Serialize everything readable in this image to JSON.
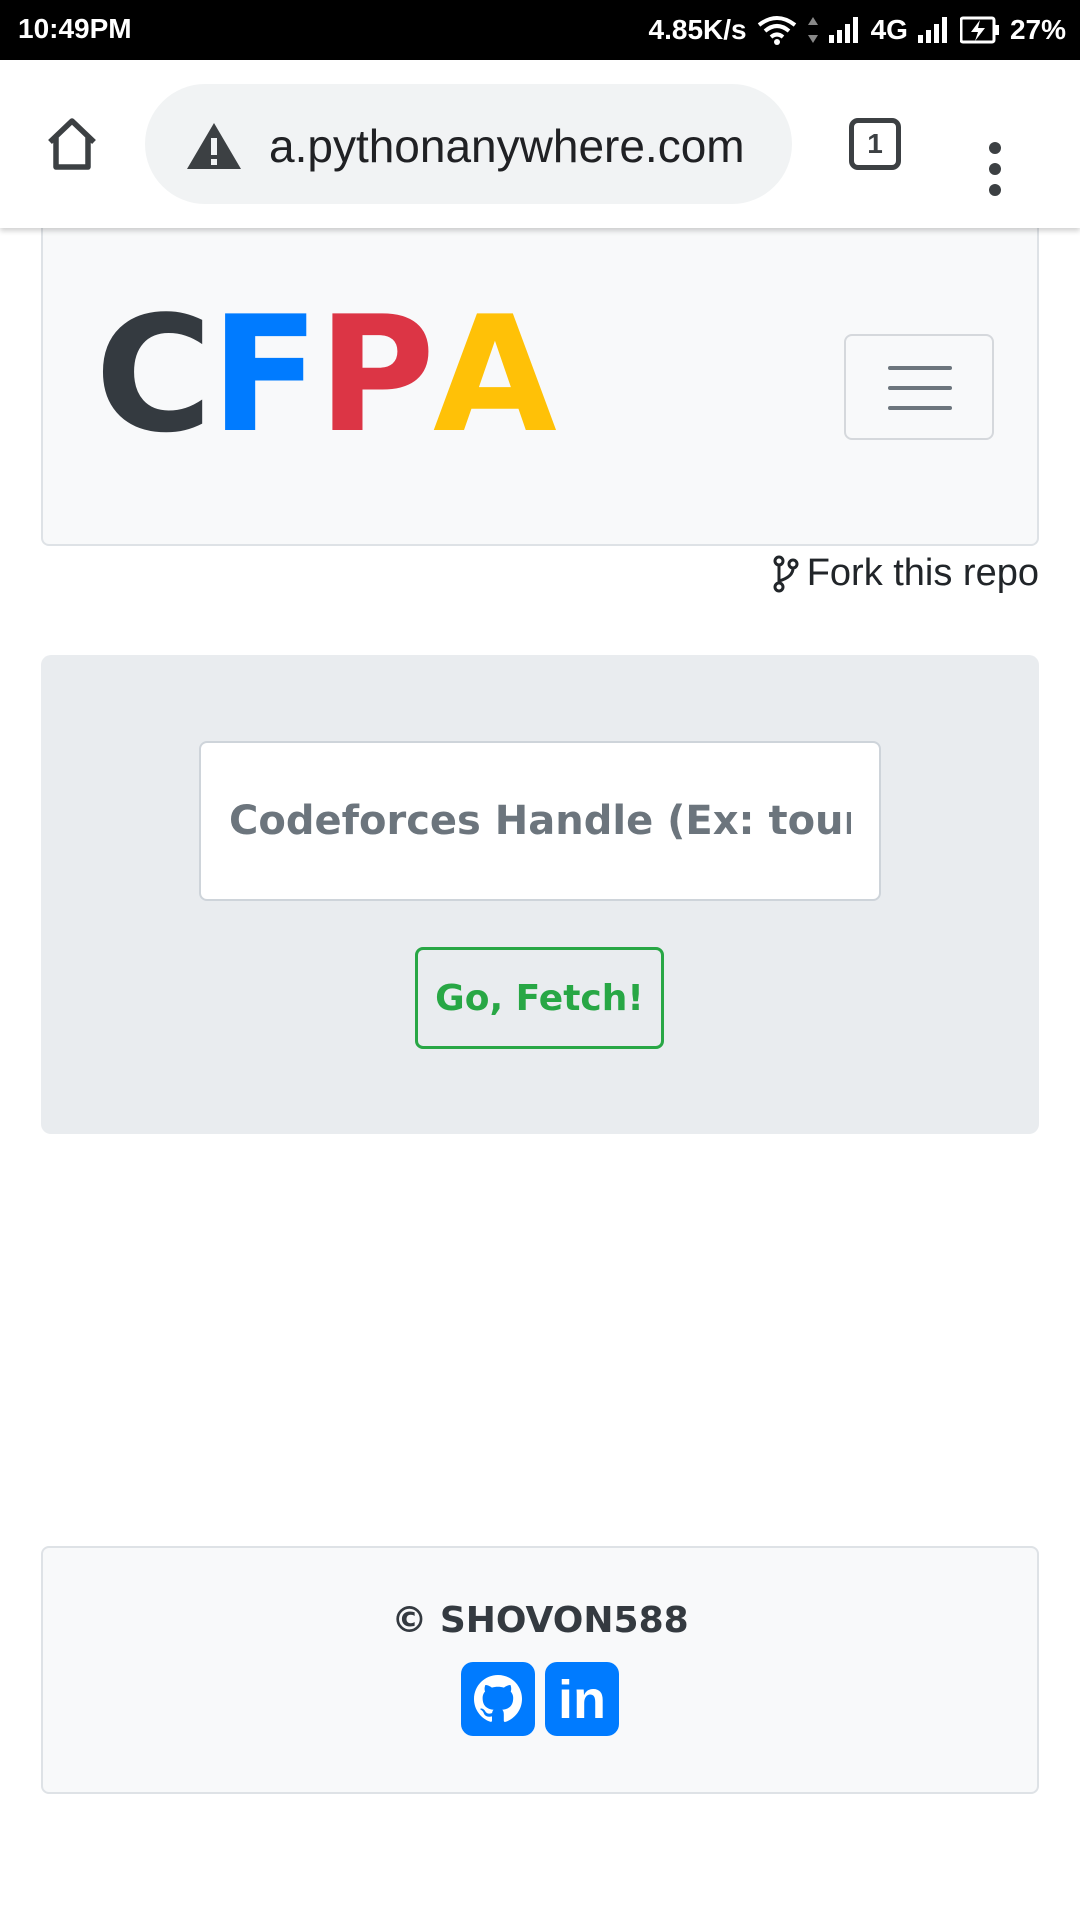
{
  "status_bar": {
    "time": "10:49PM",
    "net_speed": "4.85K/s",
    "network_type": "4G",
    "battery": "27%"
  },
  "browser": {
    "url": "a.pythonanywhere.com",
    "tab_count": "1"
  },
  "navbar": {
    "logo_letters": [
      "C",
      "F",
      "P",
      "A"
    ],
    "logo_colors": [
      "#343a40",
      "#007bff",
      "#dc3545",
      "#ffc107"
    ]
  },
  "fork_link": "Fork this repo",
  "form": {
    "handle_value": "",
    "handle_placeholder": "Codeforces Handle (Ex: tourist)",
    "submit_label": "Go, Fetch!"
  },
  "footer": {
    "copyright": "© SHOVON588",
    "social_icons": [
      "github-icon",
      "linkedin-icon"
    ],
    "linkedin_text": "in"
  },
  "colors": {
    "primary": "#007bff",
    "success": "#28a745"
  }
}
